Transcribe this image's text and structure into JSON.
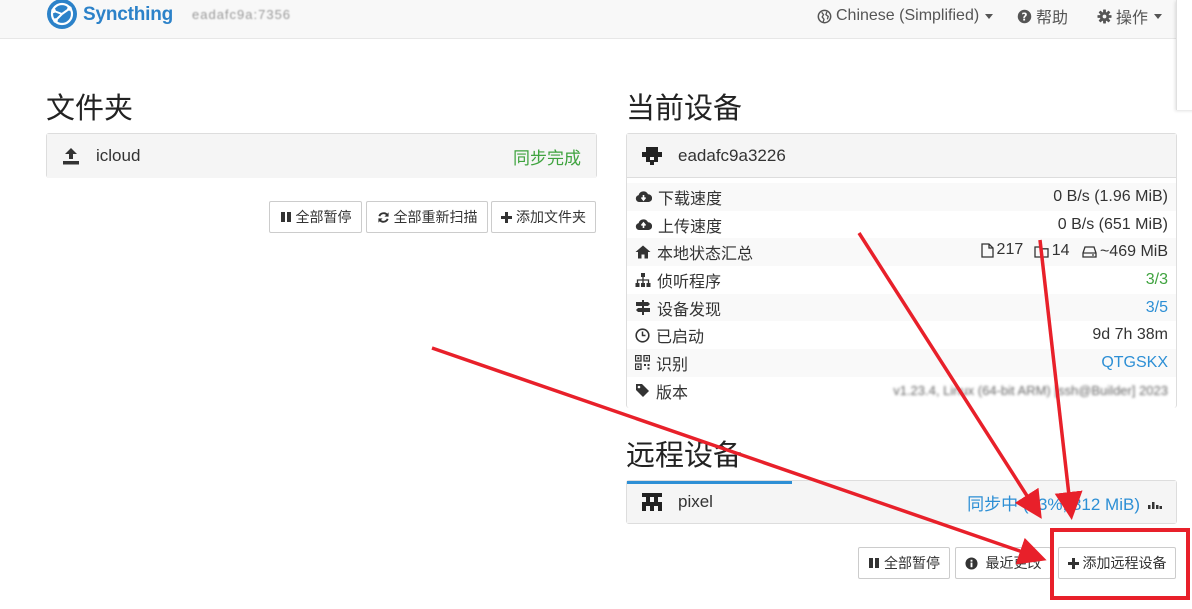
{
  "navbar": {
    "brand": "Syncthing",
    "hostname": "eadafc9a:7356",
    "language": "Chinese (Simplified)",
    "help": "帮助",
    "actions": "操作"
  },
  "folders": {
    "title": "文件夹",
    "items": [
      {
        "name": "icloud",
        "status": "同步完成"
      }
    ],
    "buttons": {
      "pause_all": "全部暂停",
      "rescan_all": "全部重新扫描",
      "add_folder": "添加文件夹"
    }
  },
  "this_device": {
    "title": "当前设备",
    "name": "eadafc9a3226",
    "stats": [
      {
        "icon": "cloud-download-icon",
        "label": "下载速度",
        "value": "0 B/s (1.96 MiB)"
      },
      {
        "icon": "cloud-upload-icon",
        "label": "上传速度",
        "value": "0 B/s (651 MiB)"
      },
      {
        "icon": "home-icon",
        "label": "本地状态汇总"
      },
      {
        "icon": "sitemap-icon",
        "label": "侦听程序",
        "value": "3/3"
      },
      {
        "icon": "signpost-icon",
        "label": "设备发现",
        "value": "3/5"
      },
      {
        "icon": "clock-icon",
        "label": "已启动",
        "value": "9d 7h 38m"
      },
      {
        "icon": "qrcode-icon",
        "label": "识别",
        "value": "QTGSKX"
      },
      {
        "icon": "tag-icon",
        "label": "版本",
        "value": "v1.23.4, Linux (64-bit ARM) [ssh@Builder] 2023"
      }
    ],
    "local_state": {
      "files": "217",
      "dirs": "14",
      "size": "~469 MiB"
    }
  },
  "remote_devices": {
    "title": "远程设备",
    "items": [
      {
        "name": "pixel",
        "status": "同步中 (93%, 312 MiB)",
        "progress": 0.3
      }
    ],
    "buttons": {
      "pause_all": "全部暂停",
      "recent_changes": "最近更改",
      "add_remote": "添加远程设备"
    }
  },
  "colors": {
    "brand": "#2c82c9",
    "success": "#3fa33f",
    "info": "#2d8fd5",
    "annotation": "#e8202a"
  }
}
